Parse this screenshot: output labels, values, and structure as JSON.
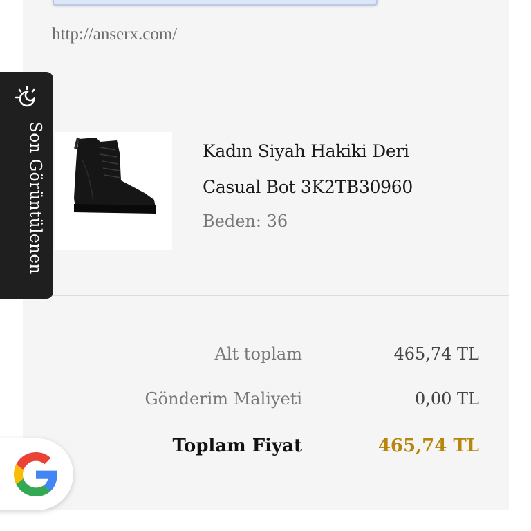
{
  "page": {
    "url_text": "http://anserx.com/"
  },
  "recently_viewed": {
    "label": "Son Görüntülenen",
    "icon": "recently-viewed-icon"
  },
  "product": {
    "title_line1": "Kadın Siyah Hakiki Deri",
    "title_line2": "Casual Bot 3K2TB30960",
    "size_label": "Beden:",
    "size_value": "36",
    "image": "black-leather-boot-image"
  },
  "summary": {
    "subtotal_label": "Alt toplam",
    "subtotal_value": "465,74 TL",
    "shipping_label": "Gönderim Maliyeti",
    "shipping_value": "0,00 TL",
    "total_label": "Toplam Fiyat",
    "total_value": "465,74 TL"
  },
  "google_button": {
    "icon": "google-icon"
  },
  "colors": {
    "panel_bg": "#f5f5f5",
    "side_tab_bg": "#1f1f1f",
    "total_accent": "#b8860b"
  }
}
